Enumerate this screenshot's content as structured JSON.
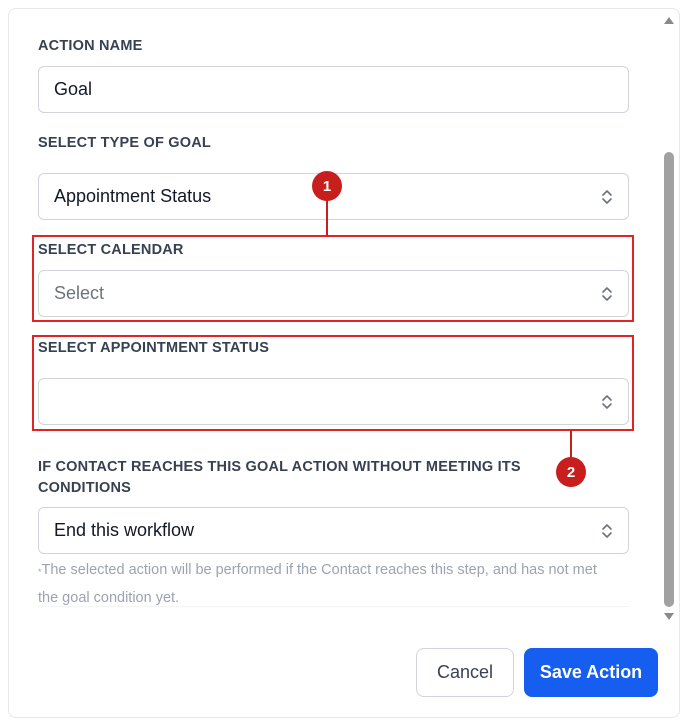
{
  "form": {
    "action_name": {
      "label": "ACTION NAME",
      "value": "Goal"
    },
    "goal_type": {
      "label": "SELECT TYPE OF GOAL",
      "value": "Appointment Status"
    },
    "calendar": {
      "label": "SELECT CALENDAR",
      "placeholder": "Select"
    },
    "appointment_status": {
      "label": "SELECT APPOINTMENT STATUS",
      "value": ""
    },
    "fallback": {
      "label_line1": "IF CONTACT REACHES THIS GOAL ACTION WITHOUT MEETING ITS",
      "label_line2": "CONDITIONS",
      "value": "End this workflow",
      "helper_marker": "*",
      "helper_text": "The selected action will be performed if the Contact reaches this step, and has not met the goal condition yet."
    }
  },
  "annotations": {
    "badge_1": "1",
    "badge_2": "2"
  },
  "footer": {
    "cancel_label": "Cancel",
    "save_label": "Save Action"
  },
  "icons": {
    "select_arrows": "chevron-up-down-icon",
    "scroll_up": "triangle-up-icon",
    "scroll_down": "triangle-down-icon"
  },
  "colors": {
    "primary": "#155eef",
    "annotation": "#e02424",
    "scrollbar_thumb": "#a1a1a1"
  }
}
